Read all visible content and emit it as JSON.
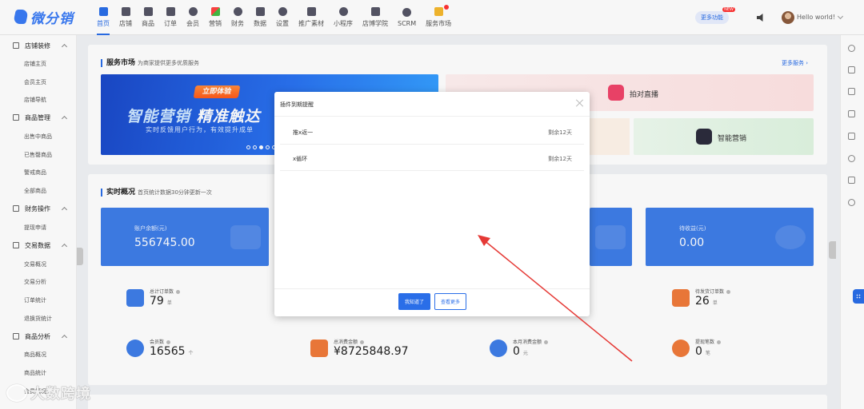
{
  "header": {
    "logo_text": "微分销",
    "nav": [
      {
        "label": "首页",
        "icon": "home-icon",
        "active": true
      },
      {
        "label": "店铺",
        "icon": "store-icon"
      },
      {
        "label": "商品",
        "icon": "product-icon"
      },
      {
        "label": "订单",
        "icon": "order-icon"
      },
      {
        "label": "会员",
        "icon": "member-icon"
      },
      {
        "label": "营销",
        "icon": "marketing-icon"
      },
      {
        "label": "财务",
        "icon": "finance-icon"
      },
      {
        "label": "数据",
        "icon": "data-icon"
      },
      {
        "label": "设置",
        "icon": "settings-icon"
      },
      {
        "label": "推广素材",
        "icon": "share-icon"
      },
      {
        "label": "小程序",
        "icon": "miniprogram-icon"
      },
      {
        "label": "店博学院",
        "icon": "academy-icon"
      },
      {
        "label": "SCRM",
        "icon": "scrm-icon"
      },
      {
        "label": "服务市场",
        "icon": "gift-icon"
      }
    ],
    "more_functions": "更多功能",
    "more_functions_badge": "NEW",
    "user_name": "Hello world!"
  },
  "sidebar": {
    "groups": [
      {
        "label": "店铺装修",
        "items": [
          "店铺主页",
          "会员主页",
          "店铺导航"
        ]
      },
      {
        "label": "商品管理",
        "items": [
          "出售中商品",
          "已售罄商品",
          "警戒商品",
          "全部商品"
        ]
      },
      {
        "label": "财务操作",
        "items": [
          "提现申请"
        ]
      },
      {
        "label": "交易数据",
        "items": [
          "交易概况",
          "交易分析",
          "订单统计",
          "退换货统计"
        ]
      },
      {
        "label": "商品分析",
        "items": [
          "商品概况",
          "商品统计",
          "会员概况"
        ]
      }
    ]
  },
  "service_market": {
    "title": "服务市场",
    "subtitle": "为商家提供更多优质服务",
    "more_link": "更多服务",
    "banner": {
      "button": "立即体验",
      "headline_a": "智能营销",
      "headline_b": "精准触达",
      "subline": "实时反馈用户行为，有效提升成单"
    },
    "services": [
      {
        "label": "拍对直播",
        "color": "#f0446a"
      },
      {
        "label": "智能营销",
        "color": "#2c2c3c"
      }
    ]
  },
  "realtime": {
    "title": "实时概况",
    "subtitle": "首页统计数据30分钟更新一次",
    "stats": [
      {
        "label": "账户余额(元)",
        "value": "556745.00"
      },
      {
        "label": "待收益(元)",
        "value": "0.00"
      }
    ],
    "metrics": [
      {
        "label": "总计订单数",
        "value": "79",
        "unit": "单",
        "icon": "order-list-icon",
        "color": "#3e7de8"
      },
      {
        "label": "待发货订单数",
        "value": "26",
        "unit": "单",
        "icon": "delivery-truck-icon",
        "color": "#f07a3a"
      },
      {
        "label": "会员数",
        "value": "16565",
        "unit": "个",
        "icon": "members-icon",
        "color": "#3e7de8"
      },
      {
        "label": "总消费金额",
        "value": "¥8725848.97",
        "unit": "",
        "icon": "wallet-icon",
        "color": "#f07a3a"
      },
      {
        "label": "本月消费金额",
        "value": "0",
        "unit": "元",
        "icon": "coins-icon",
        "color": "#3e7de8"
      },
      {
        "label": "提现笔数",
        "value": "0",
        "unit": "笔",
        "icon": "withdraw-icon",
        "color": "#f07a3a"
      }
    ]
  },
  "modal": {
    "title": "插件到期提醒",
    "rows": [
      {
        "name": "推x返一",
        "remain": "剩余12天"
      },
      {
        "name": "x循环",
        "remain": "剩余12天"
      }
    ],
    "confirm_button": "我知道了",
    "more_button": "查看更多"
  },
  "watermark": "大数跨境"
}
